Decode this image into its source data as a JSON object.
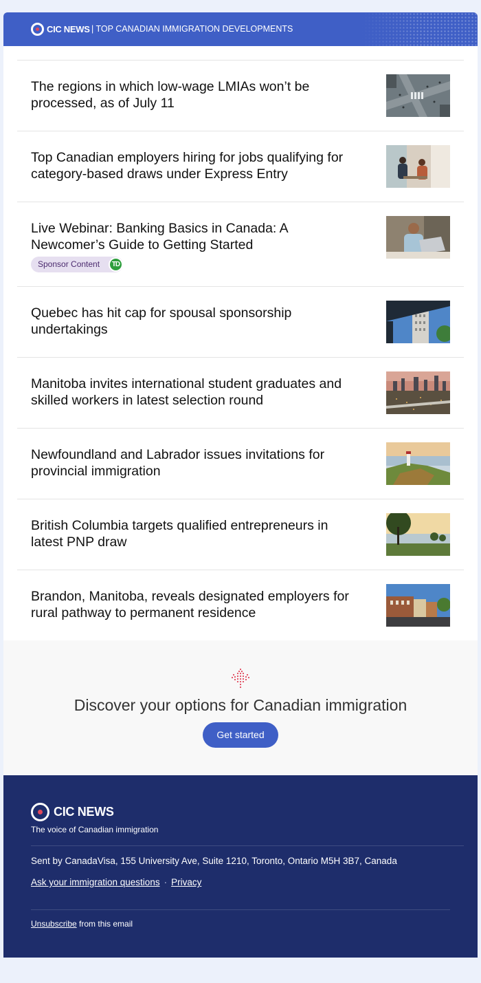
{
  "header": {
    "logo_text": "CIC NEWS",
    "tagline": "|  TOP CANADIAN IMMIGRATION DEVELOPMENTS"
  },
  "articles": [
    {
      "title": "The regions in which low-wage LMIAs won’t be processed, as of July 11",
      "image": "city-intersection-aerial"
    },
    {
      "title": "Top Canadian employers hiring for jobs qualifying for category-based draws under Express Entry",
      "image": "office-meeting"
    },
    {
      "title": "Live Webinar: Banking Basics in Canada: A Newcomer’s Guide to Getting Started",
      "image": "man-with-laptop",
      "sponsor": "Sponsor Content",
      "sponsor_logo": "TD"
    },
    {
      "title": "Quebec has hit cap for spousal sponsorship undertakings",
      "image": "quebec-building"
    },
    {
      "title": "Manitoba invites international student graduates and skilled workers in latest selection round",
      "image": "winnipeg-skyline"
    },
    {
      "title": "Newfoundland and Labrador issues invitations for provincial immigration",
      "image": "lighthouse-coast"
    },
    {
      "title": "British Columbia targets qualified entrepreneurs in latest PNP draw",
      "image": "park-sunset"
    },
    {
      "title": "Brandon, Manitoba, reveals designated employers for rural pathway to permanent residence",
      "image": "town-street"
    }
  ],
  "cta": {
    "heading": "Discover your options for Canadian immigration",
    "button": "Get started"
  },
  "footer": {
    "logo_text": "CIC NEWS",
    "voice": "The voice of Canadian immigration",
    "address": "Sent by CanadaVisa, 155 University Ave, Suite 1210, Toronto, Ontario M5H 3B7, Canada",
    "link_questions": "Ask your immigration questions",
    "separator": "·",
    "link_privacy": "Privacy",
    "unsubscribe": "Unsubscribe",
    "unsubscribe_suffix": " from this email"
  },
  "colors": {
    "brand_blue": "#3f5fc6",
    "footer_navy": "#1e2d6b",
    "accent_red": "#e1485c"
  }
}
